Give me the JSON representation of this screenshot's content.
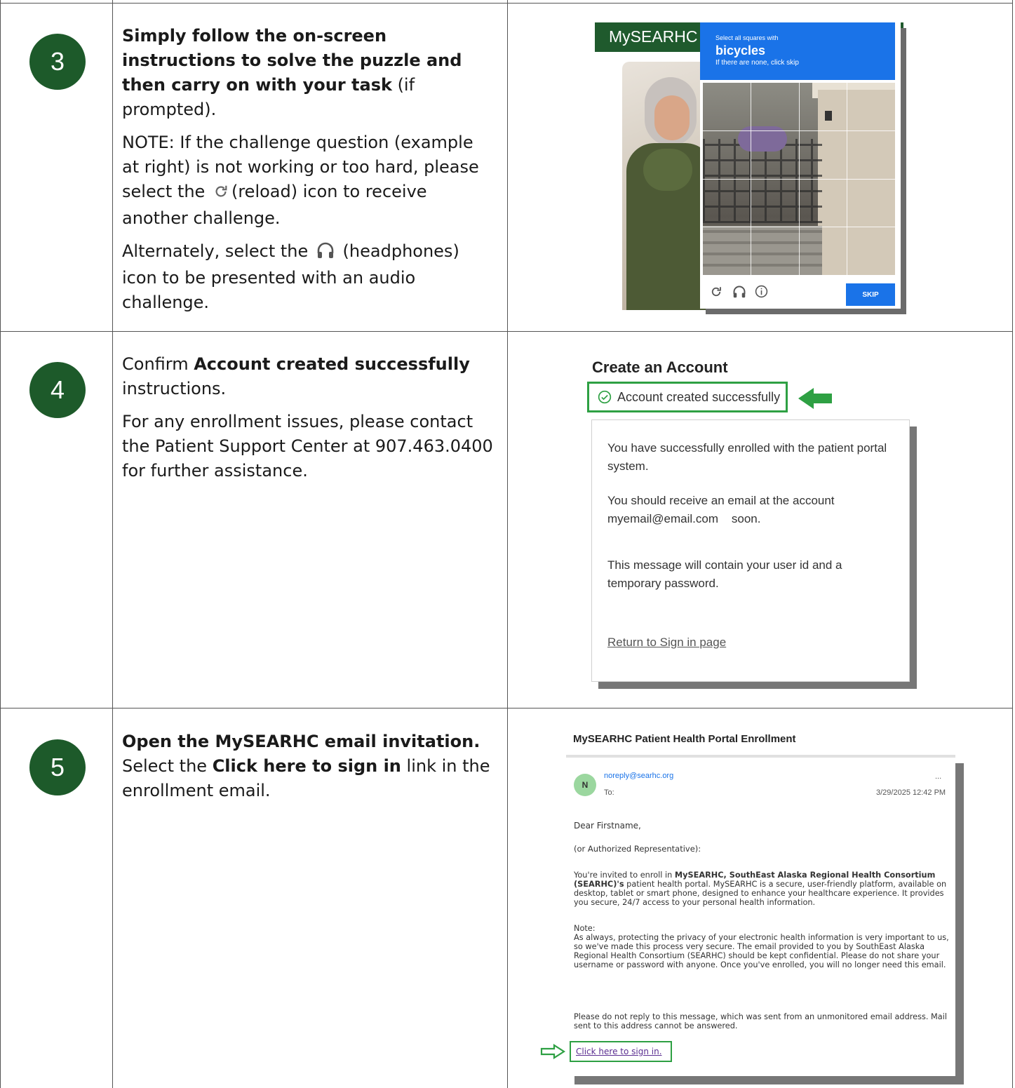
{
  "steps": [
    {
      "number": "3",
      "bold_lead": "Simply follow the on-screen instructions to solve the puzzle and then carry on with your task",
      "lead_suffix": " (if prompted).",
      "note_before_icon": "NOTE: If the challenge question (example at right) is not working or too hard, please select the",
      "note_after_icon": "(reload) icon to receive another challenge.",
      "alt_before_icon": "Alternately, select the",
      "alt_after_icon": "(headphones) icon to be presented with an audio challenge."
    },
    {
      "number": "4",
      "prefix": "Confirm ",
      "bold": "Account created successfully",
      "suffix": " instructions.",
      "para2": "For any enrollment issues, please contact the Patient Support Center at 907.463.0400 for further assistance."
    },
    {
      "number": "5",
      "bold_lead": "Open the MySEARHC email invitation.",
      "select_prefix": "Select the ",
      "select_bold": "Click here to sign in",
      "select_suffix": " link in the enrollment email."
    }
  ],
  "captcha": {
    "bg_title": "MySEARHC",
    "instruction_small": "Select all squares with",
    "target": "bicycles",
    "hint": "If there are none, click skip",
    "skip_label": "SKIP",
    "icons": [
      "reload-icon",
      "headphones-icon",
      "info-icon"
    ]
  },
  "account": {
    "title": "Create an Account",
    "success": "Account created successfully",
    "p1": "You have successfully enrolled with the patient portal system.",
    "p2a": "You should receive an email at the account",
    "p2b": "myemail@email.com    soon.",
    "p3": "This message will contain your user id and a temporary password.",
    "link": "Return to Sign in page",
    "accent_color": "#2ea043"
  },
  "email": {
    "subject": "MySEARHC Patient Health Portal Enrollment",
    "avatar_letter": "N",
    "from": "noreply@searhc.org",
    "to_label": "To:",
    "more": "...",
    "date": "3/29/2025 12:42 PM",
    "greeting": "Dear Firstname,",
    "rep": "(or Authorized Representative):",
    "intro_1": "You're invited to enroll in ",
    "intro_bold": "MySEARHC, SouthEast Alaska Regional Health Consortium (SEARHC)'s",
    "intro_2": " patient health portal. MySEARHC is a secure, user-friendly platform, available on desktop, tablet or smart phone, designed to enhance your healthcare experience. It provides you secure, 24/7 access to your personal health information.",
    "note_label": "Note:",
    "note_text": "As always, protecting the privacy of your electronic health information is very important to us, so we've made this process very secure. The email provided to you by SouthEast Alaska Regional Health Consortium (SEARHC) should be kept confidential. Please do not share your username or password with anyone. Once you've enrolled, you will no longer need this email.",
    "noreply_text": "Please do not reply to this message, which was sent from an unmonitored email address. Mail sent to this address cannot be answered.",
    "signin_link": "Click here to sign in."
  }
}
